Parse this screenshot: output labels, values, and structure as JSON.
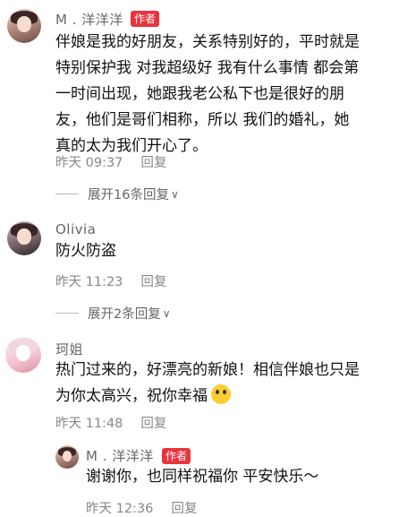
{
  "comments": [
    {
      "avatar_icon": "user-avatar-icon",
      "name": "M . 洋洋洋",
      "author_tag": "作者",
      "lines": [
        "伴娘是我的好朋友，关系特别好的，平时就是",
        "特别保护我 对我超级好 我有什么事情 都会第",
        "一时间出现，她跟我老公私下也是很好的朋",
        "友，他们是哥们相称，所以 我们的婚礼，她",
        "真的太为我们开心了。"
      ],
      "time": "昨天 09:37",
      "reply": "回复",
      "expand": "展开16条回复"
    },
    {
      "avatar_icon": "user-avatar-icon",
      "name": "Olivia",
      "lines": [
        "防火防盗"
      ],
      "time": "昨天 11:23",
      "reply": "回复",
      "expand": "展开2条回复"
    },
    {
      "avatar_icon": "user-avatar-icon",
      "name": "珂姐",
      "lines": [
        "热门过来的，好漂亮的新娘！相信伴娘也只是",
        "为你太高兴，祝你幸福"
      ],
      "emoji_icon": "heart-eyes-emoji-icon",
      "time": "昨天 11:48",
      "reply": "回复"
    }
  ],
  "nested_reply": {
    "avatar_icon": "user-avatar-icon",
    "name": "M . 洋洋洋",
    "author_tag": "作者",
    "text": "谢谢你，也同样祝福你 平安快乐～",
    "time": "昨天 12:36",
    "reply": "回复"
  },
  "colors": {
    "author_tag_bg": "#e8343d",
    "meta_gray": "#888888"
  }
}
